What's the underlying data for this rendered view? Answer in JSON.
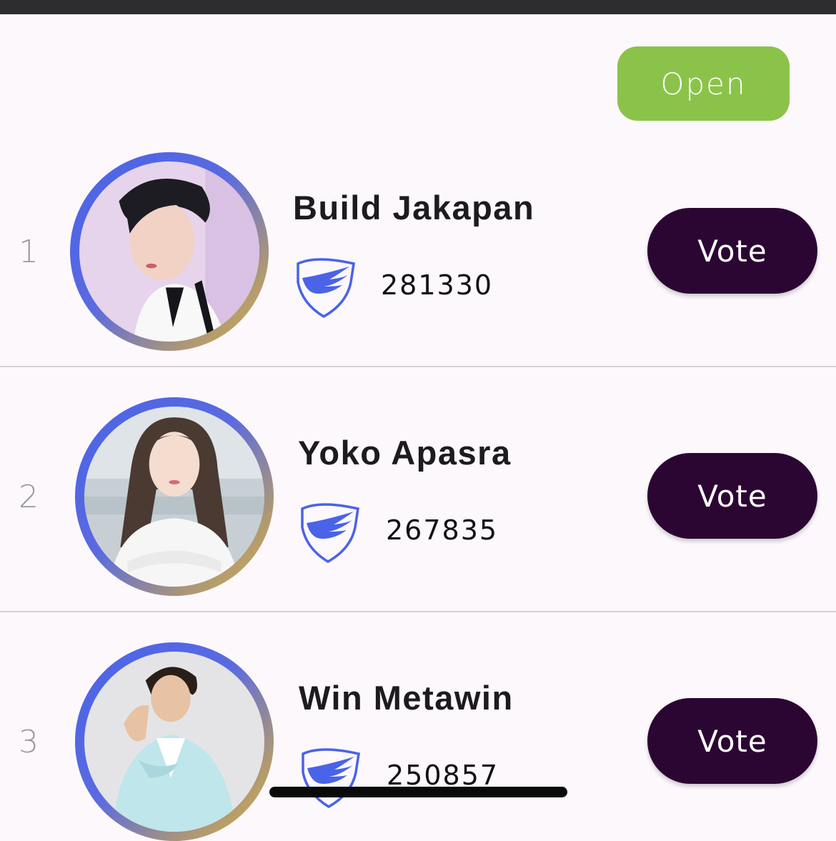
{
  "header": {
    "open_label": "Open"
  },
  "accent_colors": {
    "open_button": "#8bc34a",
    "vote_button": "#2c0633",
    "badge": "#4a63e8",
    "ring_start": "#4a63e8",
    "ring_end": "#d1b24a"
  },
  "entries": [
    {
      "rank": "1",
      "name": "Build Jakapan",
      "votes": "281330",
      "vote_label": "Vote",
      "badge_icon": "winged-shield-icon"
    },
    {
      "rank": "2",
      "name": "Yoko Apasra",
      "votes": "267835",
      "vote_label": "Vote",
      "badge_icon": "winged-shield-icon"
    },
    {
      "rank": "3",
      "name": "Win Metawin",
      "votes": "250857",
      "vote_label": "Vote",
      "badge_icon": "winged-shield-icon"
    }
  ]
}
